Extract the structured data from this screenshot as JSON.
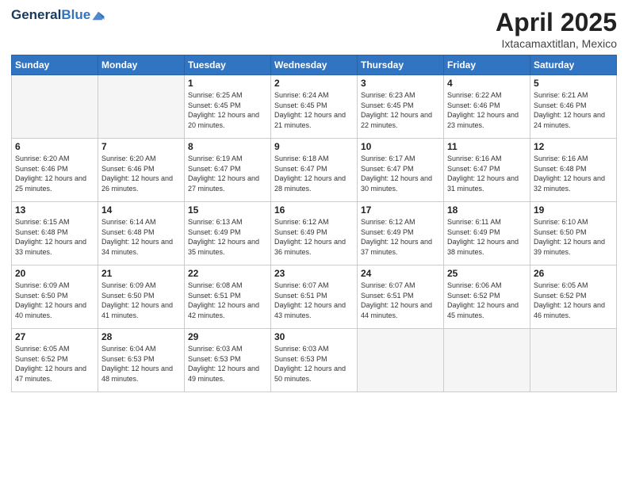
{
  "header": {
    "logo_general": "General",
    "logo_blue": "Blue",
    "month_title": "April 2025",
    "location": "Ixtacamaxtitlan, Mexico"
  },
  "days_of_week": [
    "Sunday",
    "Monday",
    "Tuesday",
    "Wednesday",
    "Thursday",
    "Friday",
    "Saturday"
  ],
  "weeks": [
    [
      {
        "day": "",
        "info": ""
      },
      {
        "day": "",
        "info": ""
      },
      {
        "day": "1",
        "info": "Sunrise: 6:25 AM\nSunset: 6:45 PM\nDaylight: 12 hours\nand 20 minutes."
      },
      {
        "day": "2",
        "info": "Sunrise: 6:24 AM\nSunset: 6:45 PM\nDaylight: 12 hours\nand 21 minutes."
      },
      {
        "day": "3",
        "info": "Sunrise: 6:23 AM\nSunset: 6:45 PM\nDaylight: 12 hours\nand 22 minutes."
      },
      {
        "day": "4",
        "info": "Sunrise: 6:22 AM\nSunset: 6:46 PM\nDaylight: 12 hours\nand 23 minutes."
      },
      {
        "day": "5",
        "info": "Sunrise: 6:21 AM\nSunset: 6:46 PM\nDaylight: 12 hours\nand 24 minutes."
      }
    ],
    [
      {
        "day": "6",
        "info": "Sunrise: 6:20 AM\nSunset: 6:46 PM\nDaylight: 12 hours\nand 25 minutes."
      },
      {
        "day": "7",
        "info": "Sunrise: 6:20 AM\nSunset: 6:46 PM\nDaylight: 12 hours\nand 26 minutes."
      },
      {
        "day": "8",
        "info": "Sunrise: 6:19 AM\nSunset: 6:47 PM\nDaylight: 12 hours\nand 27 minutes."
      },
      {
        "day": "9",
        "info": "Sunrise: 6:18 AM\nSunset: 6:47 PM\nDaylight: 12 hours\nand 28 minutes."
      },
      {
        "day": "10",
        "info": "Sunrise: 6:17 AM\nSunset: 6:47 PM\nDaylight: 12 hours\nand 30 minutes."
      },
      {
        "day": "11",
        "info": "Sunrise: 6:16 AM\nSunset: 6:47 PM\nDaylight: 12 hours\nand 31 minutes."
      },
      {
        "day": "12",
        "info": "Sunrise: 6:16 AM\nSunset: 6:48 PM\nDaylight: 12 hours\nand 32 minutes."
      }
    ],
    [
      {
        "day": "13",
        "info": "Sunrise: 6:15 AM\nSunset: 6:48 PM\nDaylight: 12 hours\nand 33 minutes."
      },
      {
        "day": "14",
        "info": "Sunrise: 6:14 AM\nSunset: 6:48 PM\nDaylight: 12 hours\nand 34 minutes."
      },
      {
        "day": "15",
        "info": "Sunrise: 6:13 AM\nSunset: 6:49 PM\nDaylight: 12 hours\nand 35 minutes."
      },
      {
        "day": "16",
        "info": "Sunrise: 6:12 AM\nSunset: 6:49 PM\nDaylight: 12 hours\nand 36 minutes."
      },
      {
        "day": "17",
        "info": "Sunrise: 6:12 AM\nSunset: 6:49 PM\nDaylight: 12 hours\nand 37 minutes."
      },
      {
        "day": "18",
        "info": "Sunrise: 6:11 AM\nSunset: 6:49 PM\nDaylight: 12 hours\nand 38 minutes."
      },
      {
        "day": "19",
        "info": "Sunrise: 6:10 AM\nSunset: 6:50 PM\nDaylight: 12 hours\nand 39 minutes."
      }
    ],
    [
      {
        "day": "20",
        "info": "Sunrise: 6:09 AM\nSunset: 6:50 PM\nDaylight: 12 hours\nand 40 minutes."
      },
      {
        "day": "21",
        "info": "Sunrise: 6:09 AM\nSunset: 6:50 PM\nDaylight: 12 hours\nand 41 minutes."
      },
      {
        "day": "22",
        "info": "Sunrise: 6:08 AM\nSunset: 6:51 PM\nDaylight: 12 hours\nand 42 minutes."
      },
      {
        "day": "23",
        "info": "Sunrise: 6:07 AM\nSunset: 6:51 PM\nDaylight: 12 hours\nand 43 minutes."
      },
      {
        "day": "24",
        "info": "Sunrise: 6:07 AM\nSunset: 6:51 PM\nDaylight: 12 hours\nand 44 minutes."
      },
      {
        "day": "25",
        "info": "Sunrise: 6:06 AM\nSunset: 6:52 PM\nDaylight: 12 hours\nand 45 minutes."
      },
      {
        "day": "26",
        "info": "Sunrise: 6:05 AM\nSunset: 6:52 PM\nDaylight: 12 hours\nand 46 minutes."
      }
    ],
    [
      {
        "day": "27",
        "info": "Sunrise: 6:05 AM\nSunset: 6:52 PM\nDaylight: 12 hours\nand 47 minutes."
      },
      {
        "day": "28",
        "info": "Sunrise: 6:04 AM\nSunset: 6:53 PM\nDaylight: 12 hours\nand 48 minutes."
      },
      {
        "day": "29",
        "info": "Sunrise: 6:03 AM\nSunset: 6:53 PM\nDaylight: 12 hours\nand 49 minutes."
      },
      {
        "day": "30",
        "info": "Sunrise: 6:03 AM\nSunset: 6:53 PM\nDaylight: 12 hours\nand 50 minutes."
      },
      {
        "day": "",
        "info": ""
      },
      {
        "day": "",
        "info": ""
      },
      {
        "day": "",
        "info": ""
      }
    ]
  ]
}
